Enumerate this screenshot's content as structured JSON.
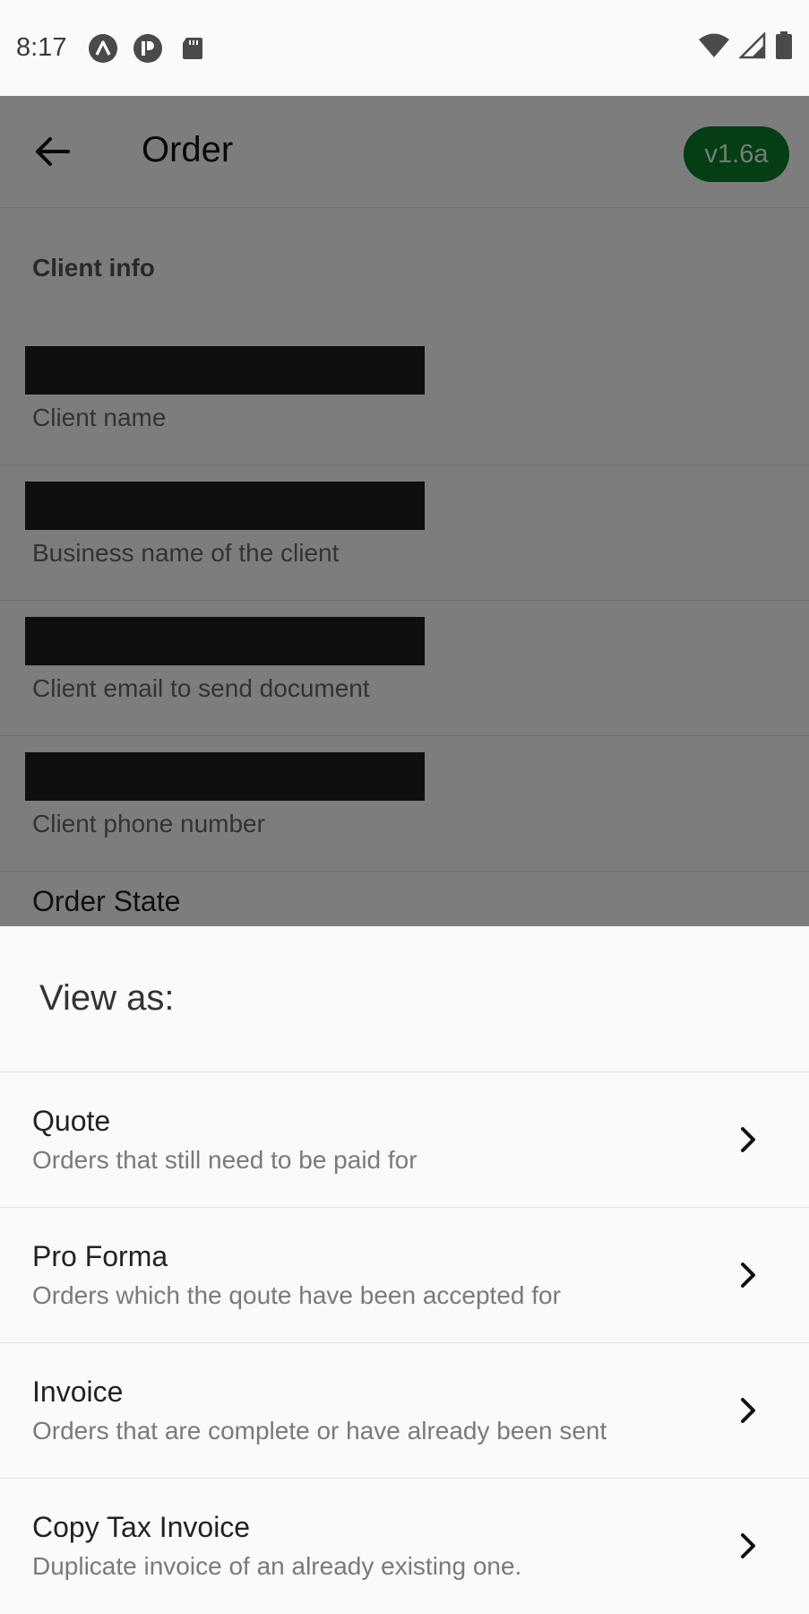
{
  "status_bar": {
    "time": "8:17",
    "left_icons": [
      "app-a-icon",
      "app-p-icon",
      "sd-card-icon"
    ],
    "right_icons": [
      "wifi-icon",
      "signal-icon",
      "battery-icon"
    ]
  },
  "app_bar": {
    "back_icon": "arrow-back-icon",
    "title": "Order",
    "version": "v1.6a",
    "version_color": "#0a7a28"
  },
  "form": {
    "section_heading": "Client info",
    "fields": [
      {
        "label": "Client name",
        "value": "[redacted]"
      },
      {
        "label": "Business name of the client",
        "value": "[redacted]"
      },
      {
        "label": "Client email to send document",
        "value": "[redacted]"
      },
      {
        "label": "Client phone number",
        "value": "[redacted]"
      }
    ],
    "order_state_label": "Order State"
  },
  "sheet": {
    "title": "View as:",
    "options": [
      {
        "title": "Quote",
        "description": "Orders that still need to be paid for"
      },
      {
        "title": "Pro Forma",
        "description": "Orders which the qoute have been accepted for"
      },
      {
        "title": "Invoice",
        "description": "Orders that are complete or have already been sent"
      },
      {
        "title": "Copy Tax Invoice",
        "description": "Duplicate invoice of an already existing one."
      }
    ]
  }
}
